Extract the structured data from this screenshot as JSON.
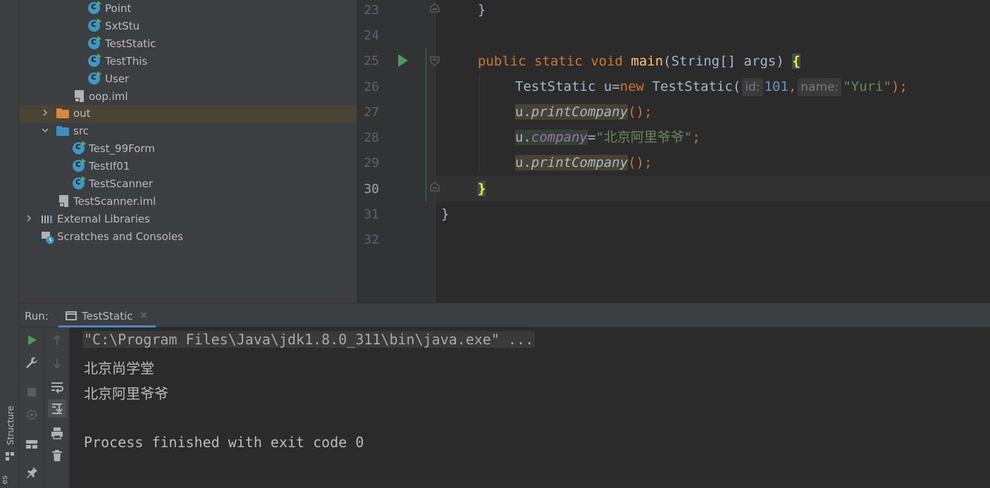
{
  "project_tree": {
    "items": [
      {
        "label": "Point",
        "icon": "java-class-runnable-icon"
      },
      {
        "label": "SxtStu",
        "icon": "java-class-runnable-icon"
      },
      {
        "label": "TestStatic",
        "icon": "java-class-runnable-icon"
      },
      {
        "label": "TestThis",
        "icon": "java-class-runnable-icon"
      },
      {
        "label": "User",
        "icon": "java-class-runnable-icon"
      },
      {
        "label": "oop.iml",
        "icon": "module-file-icon"
      },
      {
        "label": "out",
        "icon": "excluded-folder-icon",
        "expanded": false,
        "selected": true
      },
      {
        "label": "src",
        "icon": "source-folder-icon",
        "expanded": true
      },
      {
        "label": "Test_99Form",
        "icon": "java-class-runnable-icon"
      },
      {
        "label": "TestIf01",
        "icon": "java-class-runnable-icon"
      },
      {
        "label": "TestScanner",
        "icon": "java-class-runnable-icon"
      },
      {
        "label": "TestScanner.iml",
        "icon": "module-file-icon"
      },
      {
        "label": "External Libraries",
        "icon": "libraries-icon",
        "expanded": false
      },
      {
        "label": "Scratches and Consoles",
        "icon": "scratches-icon"
      }
    ]
  },
  "editor": {
    "current_line": "30",
    "line_numbers": [
      "23",
      "24",
      "25",
      "26",
      "27",
      "28",
      "29",
      "30",
      "31",
      "32"
    ],
    "code": {
      "l23_brace": "}",
      "l25_public": "public",
      "l25_static": "static",
      "l25_void": "void",
      "l25_main": "main",
      "l25_params": "(String[] args) ",
      "l25_brace": "{",
      "l26_type": "TestStatic ",
      "l26_var": "u",
      "l26_eq": "=",
      "l26_new": "new",
      "l26_ctor": " TestStatic(",
      "l26_hint_id": "id:",
      "l26_num": "101",
      "l26_comma": ",",
      "l26_hint_name": "name:",
      "l26_str": "\"Yuri\"",
      "l26_end": ");",
      "l27_var": "u",
      "l27_dot": ".",
      "l27_method": "printCompany",
      "l27_end": "();",
      "l28_var": "u",
      "l28_dot": ".",
      "l28_field": "company",
      "l28_eq": "=",
      "l28_str": "\"北京阿里爷爷\"",
      "l28_end": ";",
      "l29_var": "u",
      "l29_dot": ".",
      "l29_method": "printCompany",
      "l29_end": "();",
      "l30_brace": "}",
      "l31_brace": "}"
    }
  },
  "run_window": {
    "label": "Run:",
    "tab_label": "TestStatic",
    "tab_close": "×",
    "output": {
      "command": "\"C:\\Program Files\\Java\\jdk1.8.0_311\\bin\\java.exe\" ...",
      "line1": "北京尚学堂",
      "line2": "北京阿里爷爷",
      "exit": "Process finished with exit code 0"
    }
  },
  "side_strip": {
    "structure_label": "Structure",
    "bottom_label": "es"
  },
  "colors": {
    "keyword": "#cc7832",
    "method_decl": "#ffc66d",
    "string": "#6a8759",
    "number": "#6897bb",
    "field": "#9876aa",
    "run_green": "#499c54"
  }
}
